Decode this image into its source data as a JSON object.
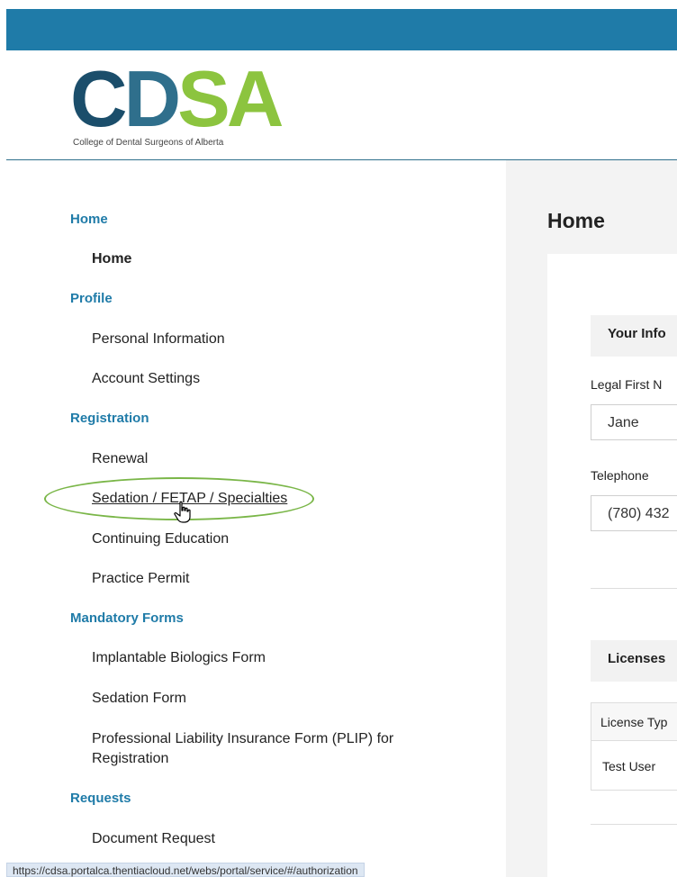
{
  "logo": {
    "letters": [
      "C",
      "D",
      "S",
      "A"
    ],
    "tagline": "College of Dental Surgeons of Alberta"
  },
  "colors": {
    "topbar": "#1f7ba8",
    "section_heading": "#1f7ba8",
    "logo_dark": "#1b4e6b",
    "logo_mid": "#2f6f8c",
    "logo_green": "#8cc43f",
    "highlight_oval": "#7ab648"
  },
  "sidebar": {
    "sections": [
      {
        "heading": "Home",
        "items": [
          "Home"
        ]
      },
      {
        "heading": "Profile",
        "items": [
          "Personal Information",
          "Account Settings"
        ]
      },
      {
        "heading": "Registration",
        "items": [
          "Renewal",
          "Sedation / FETAP / Specialties",
          "Continuing Education",
          "Practice Permit"
        ]
      },
      {
        "heading": "Mandatory Forms",
        "items": [
          "Implantable Biologics Form",
          "Sedation Form",
          "Professional Liability Insurance Form (PLIP) for",
          "Registration"
        ]
      },
      {
        "heading": "Requests",
        "items": [
          "Document Request"
        ]
      }
    ]
  },
  "main": {
    "title": "Home",
    "your_info_heading": "Your Info",
    "legal_first_name_label": "Legal First N",
    "legal_first_name_value": "Jane",
    "telephone_label": "Telephone",
    "telephone_value": "(780) 432",
    "licenses_heading": "Licenses",
    "licenses_table": {
      "header": "License Typ",
      "row": "Test User"
    }
  },
  "statusbar": {
    "url": "https://cdsa.portalca.thentiacloud.net/webs/portal/service/#/authorization"
  },
  "cursor": {
    "icon": "hand-pointer-icon"
  }
}
